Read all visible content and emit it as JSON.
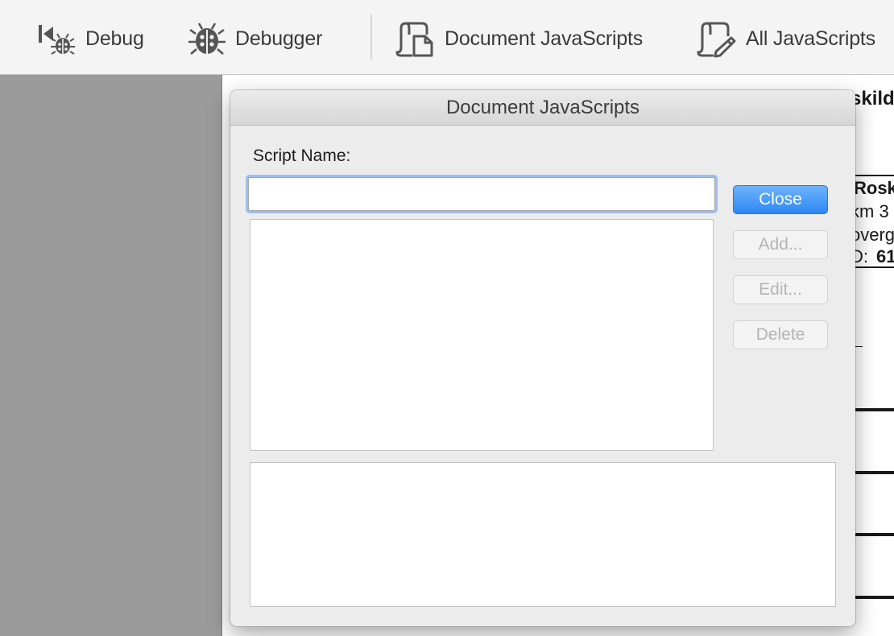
{
  "toolbar": {
    "items": [
      {
        "label": "Debug",
        "icon": "debug-step-icon"
      },
      {
        "label": "Debugger",
        "icon": "bug-icon"
      },
      {
        "label": "Document JavaScripts",
        "icon": "document-script-icon"
      },
      {
        "label": "All JavaScripts",
        "icon": "script-edit-icon"
      }
    ]
  },
  "background_doc": {
    "fragments": [
      "skild",
      "Rosk",
      "km 3",
      "overg",
      "D: ",
      "61"
    ]
  },
  "dialog": {
    "title": "Document JavaScripts",
    "script_name_label": "Script Name:",
    "script_name_value": "",
    "buttons": {
      "close": "Close",
      "add": "Add...",
      "edit": "Edit...",
      "delete": "Delete"
    }
  },
  "colors": {
    "accent": "#2e87f5",
    "focus_ring": "#9cbfec",
    "toolbar_bg": "#f4f4f4"
  }
}
